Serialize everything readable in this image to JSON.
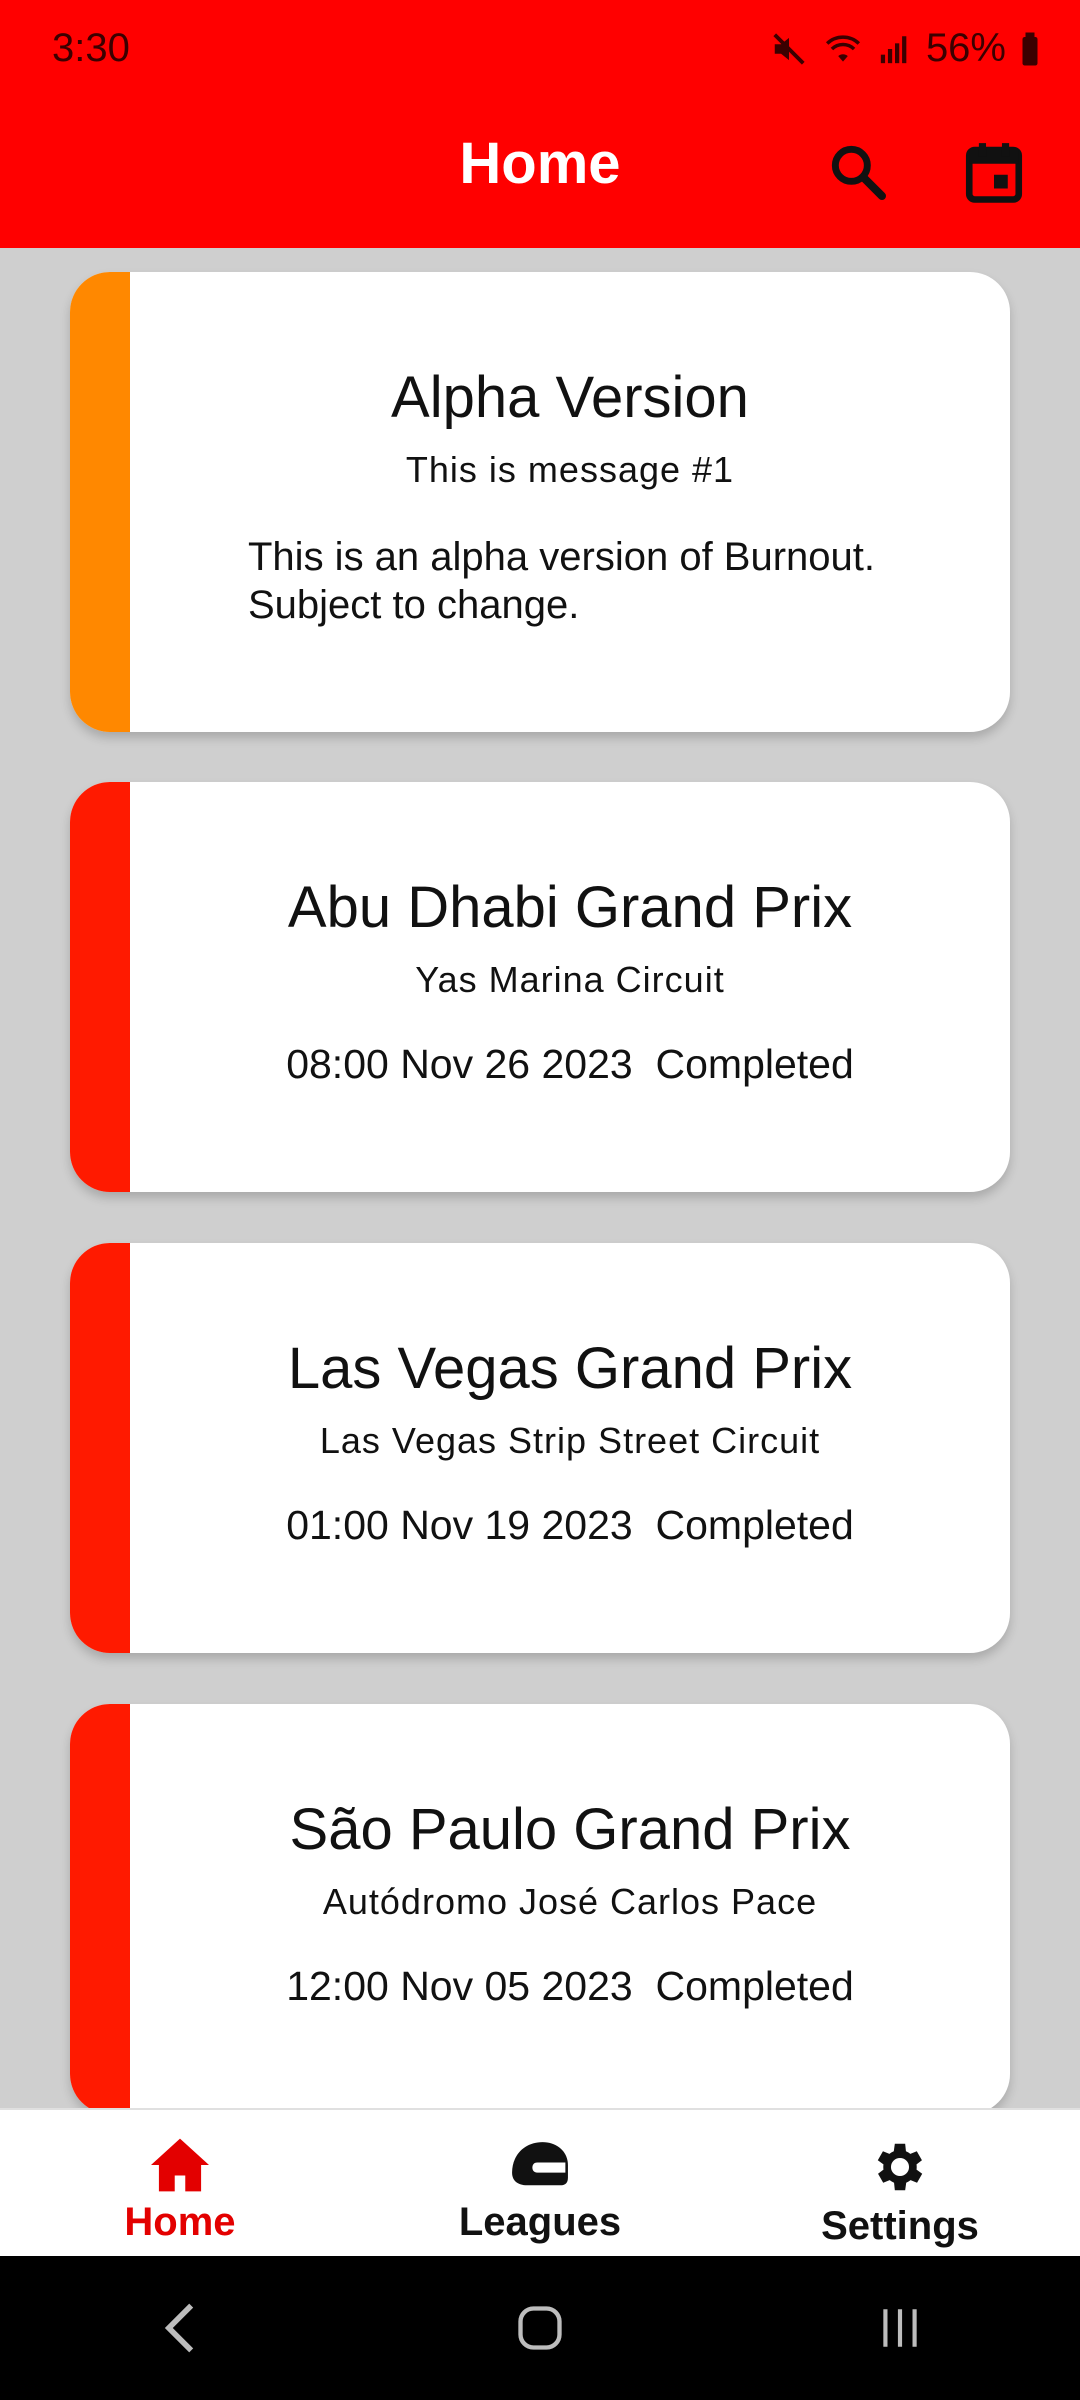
{
  "status_bar": {
    "time": "3:30",
    "battery": "56%"
  },
  "app_bar": {
    "title": "Home",
    "search_icon": "search-icon",
    "calendar_icon": "calendar-icon"
  },
  "colors": {
    "primary": "#ff0000",
    "warning_accent": "#ff8800",
    "race_accent": "#ff1a00",
    "background": "#cfcfcf"
  },
  "message_card": {
    "title": "Alpha Version",
    "subtitle": "This is message #1",
    "body": "This is an alpha version of Burnout. Subject to change."
  },
  "races": [
    {
      "name": "Abu Dhabi Grand Prix",
      "circuit": "Yas Marina Circuit",
      "datetime": "08:00 Nov 26 2023",
      "status": "Completed"
    },
    {
      "name": "Las Vegas Grand Prix",
      "circuit": "Las Vegas Strip Street Circuit",
      "datetime": "01:00 Nov 19 2023",
      "status": "Completed"
    },
    {
      "name": "São Paulo Grand Prix",
      "circuit": "Autódromo José Carlos Pace",
      "datetime": "12:00 Nov 05 2023",
      "status": "Completed"
    }
  ],
  "bottom_nav": [
    {
      "label": "Home",
      "icon": "home-icon",
      "active": true
    },
    {
      "label": "Leagues",
      "icon": "helmet-icon",
      "active": false
    },
    {
      "label": "Settings",
      "icon": "gear-icon",
      "active": false
    }
  ]
}
